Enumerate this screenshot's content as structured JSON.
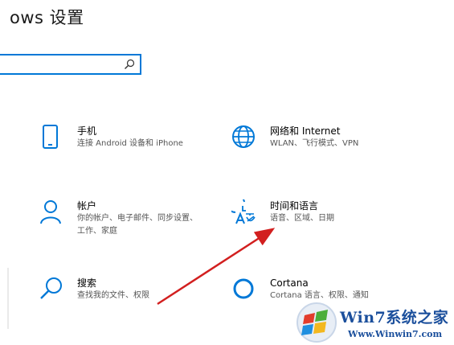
{
  "window": {
    "title": "ows 设置"
  },
  "search": {
    "placeholder": "",
    "value": ""
  },
  "tiles": [
    {
      "name": "手机",
      "desc": "连接 Android 设备和 iPhone",
      "icon": "phone-icon"
    },
    {
      "name": "网络和 Internet",
      "desc": "WLAN、飞行模式、VPN",
      "icon": "globe-icon"
    },
    {
      "name": "帐户",
      "desc": "你的帐户、电子邮件、同步设置、工作、家庭",
      "icon": "person-icon"
    },
    {
      "name": "时间和语言",
      "desc": "语音、区域、日期",
      "icon": "time-language-icon"
    },
    {
      "name": "搜索",
      "desc": "查找我的文件、权限",
      "icon": "search-icon"
    },
    {
      "name": "Cortana",
      "desc": "Cortana 语言、权限、通知",
      "icon": "cortana-icon"
    }
  ],
  "watermark": {
    "title": "Win7系统之家",
    "url": "Www.Winwin7.com"
  },
  "colors": {
    "accent": "#0078d7",
    "annotation_arrow": "#d21f1f"
  }
}
